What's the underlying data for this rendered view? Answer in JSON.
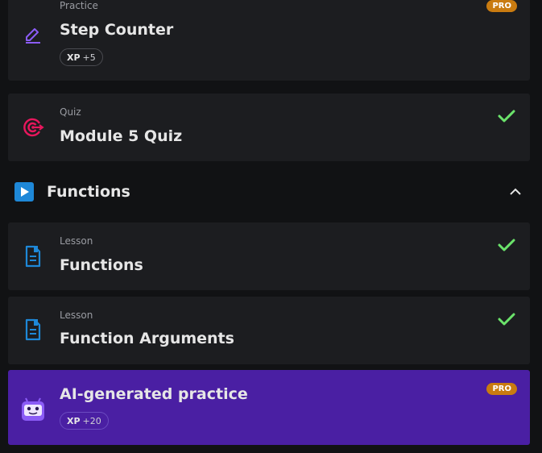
{
  "items": [
    {
      "type_label": "Practice",
      "title": "Step Counter",
      "xp_label": "XP",
      "xp_value": "+5",
      "badge": "PRO"
    },
    {
      "type_label": "Quiz",
      "title": "Module 5 Quiz",
      "completed": true
    },
    {
      "type_label": "Lesson",
      "title": "Functions",
      "completed": true
    },
    {
      "type_label": "Lesson",
      "title": "Function Arguments",
      "completed": true
    },
    {
      "title": "AI-generated practice",
      "xp_label": "XP",
      "xp_value": "+20",
      "badge": "PRO"
    }
  ],
  "section": {
    "title": "Functions",
    "expanded": true
  },
  "colors": {
    "check": "#6be36b",
    "pro_badge": "#c97b10",
    "ai_card": "#4a1fa3",
    "quiz_icon": "#e8175d",
    "lesson_icon": "#1e88d8",
    "practice_icon": "#8b5cf6"
  },
  "icons": {
    "practice": "pencil-edit-icon",
    "quiz": "target-icon",
    "lesson": "document-icon",
    "section": "play-icon",
    "collapse": "chevron-up-icon",
    "ai": "ai-robot-icon",
    "completed": "checkmark-icon"
  }
}
